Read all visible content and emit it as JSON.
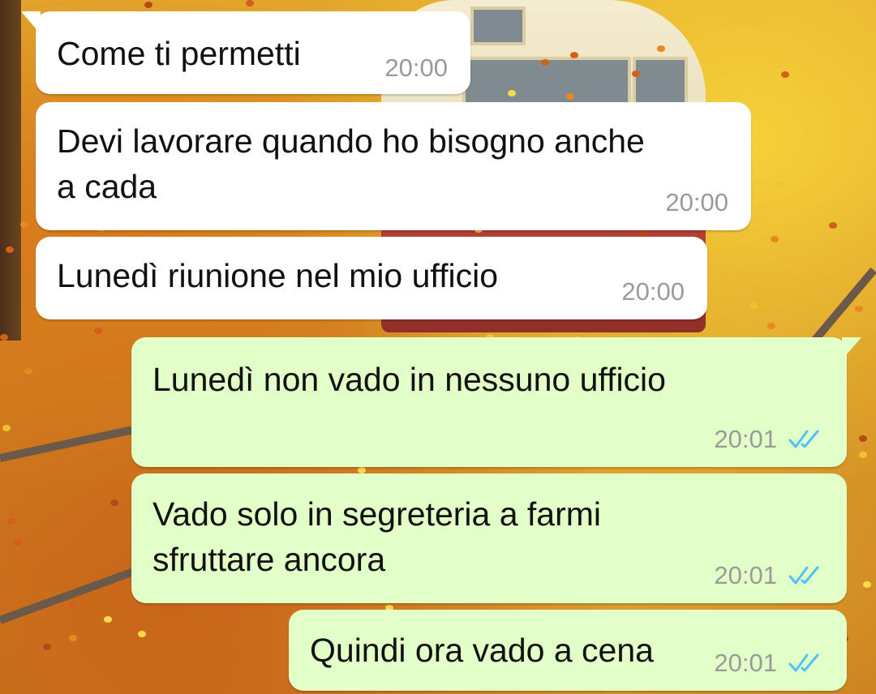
{
  "chat": {
    "tick_color": "#4fc3f7",
    "bubble_in_color": "#ffffff",
    "bubble_out_color": "#e1ffc7",
    "messages": [
      {
        "direction": "incoming",
        "text": "Come ti permetti",
        "time": "20:00"
      },
      {
        "direction": "incoming",
        "text": "Devi lavorare quando ho bisogno anche\na cada",
        "time": "20:00"
      },
      {
        "direction": "incoming",
        "text": "Lunedì riunione nel mio ufficio",
        "time": "20:00"
      },
      {
        "direction": "outgoing",
        "text": "Lunedì non vado in nessuno ufficio",
        "time": "20:01",
        "status_icon": "double-check-icon"
      },
      {
        "direction": "outgoing",
        "text": "Vado solo in segreteria a farmi\nsfruttare ancora",
        "time": "20:01",
        "status_icon": "double-check-icon"
      },
      {
        "direction": "outgoing",
        "text": "Quindi ora vado a cena",
        "time": "20:01",
        "status_icon": "double-check-icon"
      }
    ]
  }
}
